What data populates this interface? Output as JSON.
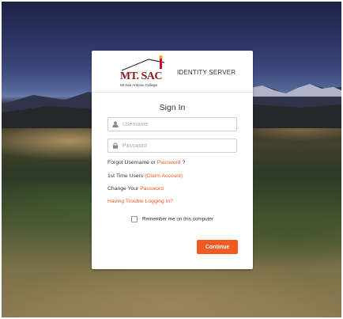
{
  "header": {
    "logo_text": "MT. SAC",
    "logo_subtext": "Mt San Antonio College",
    "title": "IDENTITY SERVER"
  },
  "form": {
    "heading": "Sign In",
    "username_placeholder": "Username",
    "password_placeholder": "Password",
    "username_icon": "user-icon",
    "password_icon": "lock-icon"
  },
  "links": {
    "forgot_prefix": "Forgot Username or",
    "forgot_link": "Password",
    "forgot_suffix": "?",
    "first_time_prefix": "1st Time Users",
    "first_time_link": "(Claim Account)",
    "change_prefix": "Change Your",
    "change_link": "Password",
    "trouble_link": "Having Trouble Logging in?"
  },
  "remember_label": "Remember me on this computer",
  "continue_label": "Continue",
  "colors": {
    "accent": "#f15a22",
    "logo_red": "#8b1a1a"
  }
}
